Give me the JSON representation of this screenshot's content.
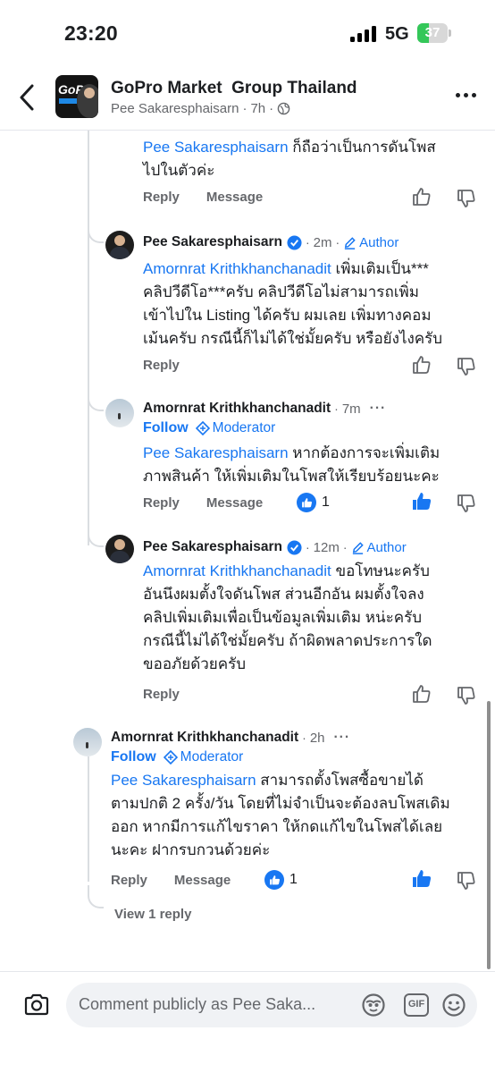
{
  "status_bar": {
    "time": "23:20",
    "network": "5G",
    "battery": "37",
    "battery_level": 0.37
  },
  "header": {
    "group_name": "GoPro Market  Group Thailand",
    "poster": "Pee Sakaresphaisarn",
    "age": "7h",
    "privacy_icon": "globe-icon",
    "avatar_logo": "GoPro"
  },
  "comments": [
    {
      "id": "c0",
      "mention": "Pee Sakaresphaisarn",
      "text_lines": [
        " ก็ถือว่าเป็นการดันโพส",
        "ไปในตัวค่ะ"
      ],
      "actions": [
        "Reply",
        "Message"
      ]
    },
    {
      "id": "c1",
      "author": "Pee Sakaresphaisarn",
      "time": "2m",
      "badge": "Author",
      "mention": "Amornrat Krithkhanchanadit",
      "text_lines": [
        " เพิ่มเติมเป็น***",
        "คลิปวีดีโอ***ครับ คลิปวีดีโอไม่สามารถเพิ่ม",
        "เข้าไปใน Listing ได้ครับ ผมเลย เพิ่มทางคอม",
        "เม้นครับ กรณีนี้ก็ไม่ได้ใช่มั้ยครับ หรือยังไงครับ"
      ],
      "actions": [
        "Reply"
      ]
    },
    {
      "id": "c2",
      "author": "Amornrat Krithkhanchanadit",
      "time": "7m",
      "follow": "Follow",
      "role": "Moderator",
      "mention": "Pee Sakaresphaisarn",
      "text_lines": [
        " หากต้องการจะเพิ่มเติม",
        "ภาพสินค้า ให้เพิ่มเติมในโพสให้เรียบร้อยนะคะ"
      ],
      "actions": [
        "Reply",
        "Message"
      ],
      "likes": "1"
    },
    {
      "id": "c3",
      "author": "Pee Sakaresphaisarn",
      "time": "12m",
      "badge": "Author",
      "mention": "Amornrat Krithkhanchanadit",
      "text_lines": [
        " ขอโทษนะครับ",
        "อันนึงผมตั้งใจดันโพส ส่วนอีกอัน ผมตั้งใจลง",
        "คลิปเพิ่มเติมเพื่อเป็นข้อมูลเพิ่มเติม หน่ะครับ",
        "กรณีนี้ไม่ได้ใช่มั้ยครับ ถ้าผิดพลาดประการใด",
        "ขออภัยด้วยครับ"
      ],
      "actions": [
        "Reply"
      ]
    },
    {
      "id": "c4",
      "author": "Amornrat Krithkhanchanadit",
      "time": "2h",
      "follow": "Follow",
      "role": "Moderator",
      "mention": "Pee Sakaresphaisarn",
      "text_lines": [
        " สามารถตั้งโพสซื้อขายได้",
        "ตามปกติ 2 ครั้ง/วัน โดยที่ไม่จำเป็นจะต้องลบโพสเดิม",
        "ออก หากมีการแก้ไขราคา ให้กดแก้ไขในโพสได้เลย",
        "นะคะ ฝากรบกวนด้วยค่ะ"
      ],
      "actions": [
        "Reply",
        "Message"
      ],
      "likes": "1"
    }
  ],
  "view_replies": "View 1 reply",
  "composer": {
    "placeholder": "Comment publicly as Pee Saka...",
    "icons": [
      "camera-icon",
      "avatar-sticker-icon",
      "gif-icon",
      "emoji-icon"
    ],
    "gif_label": "GIF"
  },
  "colors": {
    "accent": "#1877f2",
    "meta": "#65676b",
    "battery_green": "#34c759"
  }
}
